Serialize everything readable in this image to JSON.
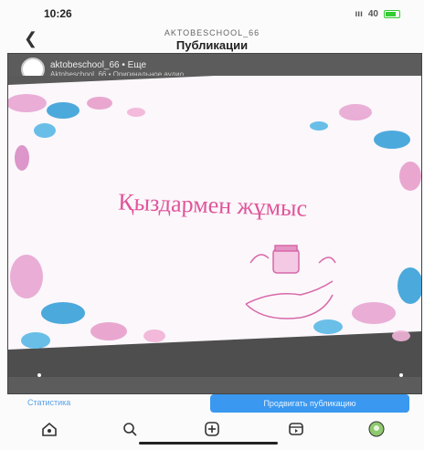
{
  "status_bar": {
    "time": "10:26",
    "signal": "40"
  },
  "header": {
    "account": "AKTOBESCHOOL_66",
    "title": "Публикации",
    "back_icon": "chevron-left-icon"
  },
  "post": {
    "username": "aktobeschool_66 • Еще",
    "subline": "Aktobeschool_66 • Оригинальное аудио",
    "caption_art": "Қыздармен жұмыс"
  },
  "actions": {
    "stats_label": "Статистика",
    "promote_label": "Продвигать публикацию"
  },
  "nav": [
    "home-icon",
    "search-icon",
    "add-post-icon",
    "reels-icon",
    "profile-icon"
  ],
  "colors": {
    "accent": "#3a98f0",
    "title_pink": "#e0559a"
  }
}
